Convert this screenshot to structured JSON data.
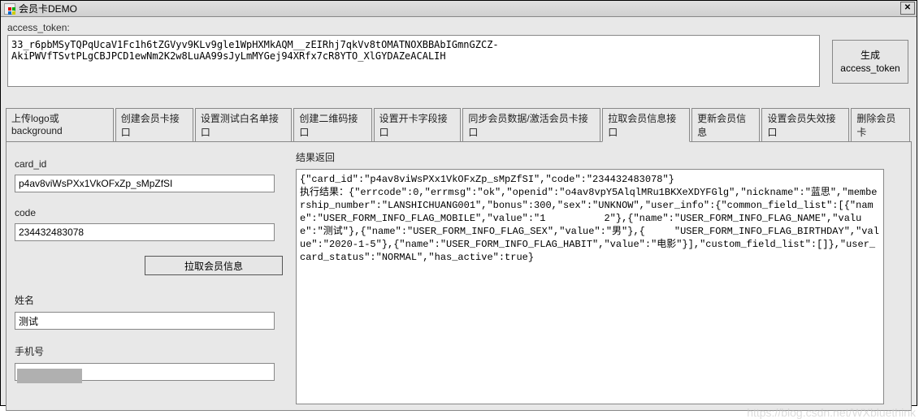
{
  "window": {
    "title": "会员卡DEMO"
  },
  "top": {
    "token_label": "access_token:",
    "token_value": "33_r6pbMSyTQPqUcaV1Fc1h6tZGVyv9KLv9gle1WpHXMkAQM__zEIRhj7qkVv8tOMATNOXBBAbIGmnGZCZ-AkiPWVfTSvtPLgCBJPCD1ewNm2K2w8LuAA99sJyLmMYGej94XRfx7cR8YTO_XlGYDAZeACALIH",
    "gen_btn": "生成\naccess_token"
  },
  "tabs": [
    {
      "label": "上传logo或background"
    },
    {
      "label": "创建会员卡接口"
    },
    {
      "label": "设置测试白名单接口"
    },
    {
      "label": "创建二维码接口"
    },
    {
      "label": "设置开卡字段接口"
    },
    {
      "label": "同步会员数据/激活会员卡接口"
    },
    {
      "label": "拉取会员信息接口",
      "active": true
    },
    {
      "label": "更新会员信息"
    },
    {
      "label": "设置会员失效接口"
    },
    {
      "label": "删除会员卡"
    }
  ],
  "form": {
    "card_id_label": "card_id",
    "card_id_value": "p4av8viWsPXx1VkOFxZp_sMpZfSI",
    "code_label": "code",
    "code_value": "234432483078",
    "fetch_btn": "拉取会员信息",
    "name_label": "姓名",
    "name_value": "测试",
    "phone_label": "手机号",
    "phone_value": ""
  },
  "result": {
    "label": "结果返回",
    "text": "{\"card_id\":\"p4av8viWsPXx1VkOFxZp_sMpZfSI\",\"code\":\"234432483078\"}\n执行结果：{\"errcode\":0,\"errmsg\":\"ok\",\"openid\":\"o4av8vpY5AlqlMRu1BKXeXDYFGlg\",\"nickname\":\"蓝思\",\"membership_number\":\"LANSHICHUANG001\",\"bonus\":300,\"sex\":\"UNKNOW\",\"user_info\":{\"common_field_list\":[{\"name\":\"USER_FORM_INFO_FLAG_MOBILE\",\"value\":\"1          2\"},{\"name\":\"USER_FORM_INFO_FLAG_NAME\",\"value\":\"测试\"},{\"name\":\"USER_FORM_INFO_FLAG_SEX\",\"value\":\"男\"},{     \"USER_FORM_INFO_FLAG_BIRTHDAY\",\"value\":\"2020-1-5\"},{\"name\":\"USER_FORM_INFO_FLAG_HABIT\",\"value\":\"电影\"}],\"custom_field_list\":[]},\"user_card_status\":\"NORMAL\",\"has_active\":true}"
  },
  "watermark": "https://blog.csdn.net/WXbluethink"
}
